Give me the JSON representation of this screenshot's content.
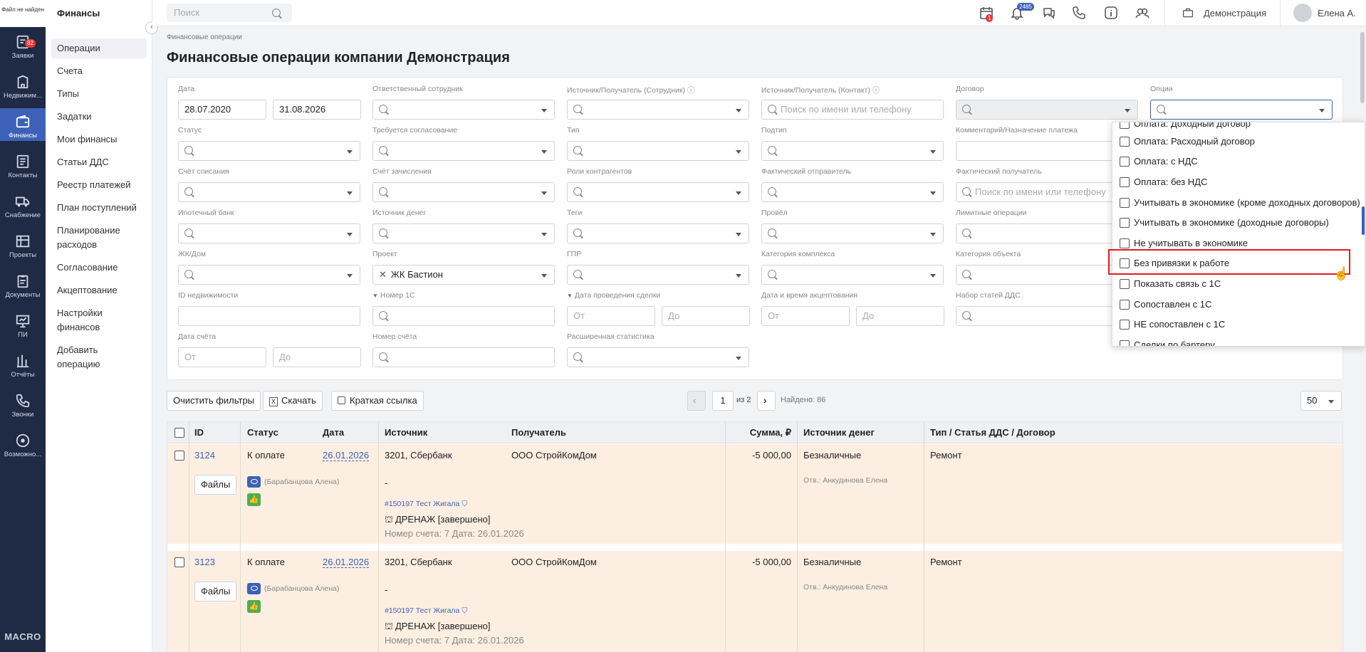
{
  "left_nav": {
    "logo_text": "Файл не найден",
    "items": [
      {
        "label": "Заявки",
        "icon": "requests-icon",
        "badge": "82"
      },
      {
        "label": "Недвижим...",
        "icon": "building-icon"
      },
      {
        "label": "Финансы",
        "icon": "wallet-icon",
        "active": true
      },
      {
        "label": "Контакты",
        "icon": "contacts-icon"
      },
      {
        "label": "Снабжение",
        "icon": "truck-icon"
      },
      {
        "label": "Проекты",
        "icon": "projects-icon"
      },
      {
        "label": "Документы",
        "icon": "documents-icon"
      },
      {
        "label": "ПИ",
        "icon": "presentation-icon"
      },
      {
        "label": "Отчёты",
        "icon": "reports-icon"
      },
      {
        "label": "Звонки",
        "icon": "phone-icon"
      },
      {
        "label": "Возможно...",
        "icon": "settings-icon"
      }
    ],
    "brand": "MACRO"
  },
  "sub_nav": {
    "title": "Финансы",
    "items": [
      {
        "label": "Операции",
        "active": true
      },
      {
        "label": "Счета"
      },
      {
        "label": "Типы"
      },
      {
        "label": "Задатки"
      },
      {
        "label": "Мои финансы"
      },
      {
        "label": "Статьи ДДС"
      },
      {
        "label": "Реестр платежей"
      },
      {
        "label": "План поступлений"
      },
      {
        "label": "Планирование расходов"
      },
      {
        "label": "Согласование"
      },
      {
        "label": "Акцептование"
      },
      {
        "label": "Настройки финансов"
      },
      {
        "label": "Добавить операцию"
      }
    ]
  },
  "topbar": {
    "search_placeholder": "Поиск",
    "calendar_badge": "1",
    "notifications_badge": "2485",
    "company": "Демонстрация",
    "user": "Елена А."
  },
  "page": {
    "breadcrumb": "Финансовые операции",
    "title": "Финансовые операции компании Демонстрация"
  },
  "filters": {
    "date_label": "Дата",
    "date_from": "28.07.2020",
    "date_to": "31.08.2026",
    "responsible_label": "Ответственный сотрудник",
    "source_employee_label": "Источник/Получатель (Сотрудник)",
    "source_contact_label": "Источник/Получатель (Контакт)",
    "source_contact_placeholder": "Поиск по имени или телефону",
    "contract_label": "Договор",
    "options_label": "Опции",
    "status_label": "Статус",
    "approval_label": "Требуется согласование",
    "type_label": "Тип",
    "subtype_label": "Подтип",
    "comment_label": "Комментарий/Назначение платежа",
    "debit_account_label": "Счёт списания",
    "credit_account_label": "Счёт зачисления",
    "counterparty_roles_label": "Роли контрагентов",
    "actual_sender_label": "Фактический отправитель",
    "actual_receiver_label": "Фактический получатель",
    "actual_receiver_placeholder": "Поиск по имени или телефону",
    "mortgage_bank_label": "Ипотечный банк",
    "money_source_label": "Источник денег",
    "tags_label": "Теги",
    "posted_label": "Провёл",
    "limit_ops_label": "Лимитные операции",
    "complex_label": "ЖК/Дом",
    "project_label": "Проект",
    "project_value": "ЖК Бастион",
    "gpr_label": "ГПР",
    "complex_category_label": "Категория комплекса",
    "object_category_label": "Категория объекта",
    "realty_id_label": "ID недвижимости",
    "number_1c_label": "Номер 1С",
    "deal_date_label": "Дата проведения сделки",
    "deal_from": "От",
    "deal_to": "До",
    "accept_date_label": "Дата и время акцептования",
    "accept_from": "От",
    "accept_to": "До",
    "dds_set_label": "Набор статей ДДС",
    "invoice_date_label": "Дата счёта",
    "invoice_from": "От",
    "invoice_to": "До",
    "invoice_number_label": "Номер счёта",
    "extended_stats_label": "Расширенная статистика"
  },
  "actions": {
    "clear": "Очистить фильтры",
    "download": "Скачать",
    "short_link": "Краткая ссылка",
    "page": "1",
    "of_pages": "из 2",
    "found": "Найдено: 86",
    "page_size": "50"
  },
  "table": {
    "headers": [
      "ID",
      "Статус",
      "Дата",
      "Источник",
      "Получатель",
      "Сумма, ₽",
      "Источник денег",
      "Тип / Статья ДДС / Договор"
    ],
    "rows": [
      {
        "id": "3124",
        "status": "К оплате",
        "date": "26.01.2026",
        "source": "3201, Сбербанк",
        "recipient": "ООО СтройКомДом",
        "amount": "-5 000,00",
        "money_source": "Безналичные",
        "type": "Ремонт",
        "files": "Файлы",
        "viewer": "(Барабанцова Алена)",
        "dash": "-",
        "link": "#150197 Тест Жигала",
        "work": "ДРЕНАЖ [завершено]",
        "invoice": "Номер счета: 7 Дата: 26.01.2026",
        "responsible": "Отв.: Анкудинова Елена"
      },
      {
        "id": "3123",
        "status": "К оплате",
        "date": "26.01.2026",
        "source": "3201, Сбербанк",
        "recipient": "ООО СтройКомДом",
        "amount": "-5 000,00",
        "money_source": "Безналичные",
        "type": "Ремонт",
        "files": "Файлы",
        "viewer": "(Барабанцова Алена)",
        "dash": "-",
        "link": "#150197 Тест Жигала",
        "work": "ДРЕНАЖ [завершено]",
        "invoice": "Номер счета: 7 Дата: 26.01.2026",
        "responsible": "Отв.: Анкудинова Елена"
      }
    ]
  },
  "options_dropdown": {
    "items": [
      "Оплата: Доходный договор",
      "Оплата: Расходный договор",
      "Оплата: с НДС",
      "Оплата: без НДС",
      "Учитывать в экономике (кроме доходных договоров)",
      "Учитывать в экономике (доходные договоры)",
      "Не учитывать в экономике",
      "Без привязки к работе",
      "Показать связь с 1С",
      "Сопоставлен с 1С",
      "НЕ сопоставлен с 1С",
      "Сделки по бартеру"
    ],
    "highlighted": "Без привязки к работе"
  },
  "colors": {
    "nav_bg": "#1f2a44",
    "accent": "#3d61b9",
    "row_bg": "#fcefe2",
    "highlight": "#e11d1d"
  }
}
